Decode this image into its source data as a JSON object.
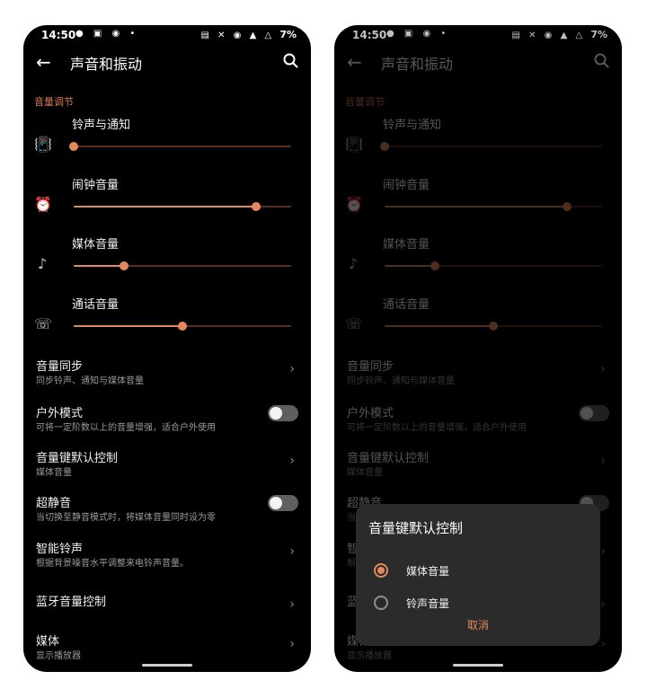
{
  "status_bar": {
    "time": "14:50",
    "battery": "7%"
  },
  "app_bar": {
    "title": "声音和振动"
  },
  "volume_section": {
    "header": "音量调节",
    "sliders": [
      {
        "label": "铃声与通知",
        "icon": "vibrate-icon",
        "value": 0.0
      },
      {
        "label": "闹钟音量",
        "icon": "alarm-icon",
        "value": 0.84
      },
      {
        "label": "媒体音量",
        "icon": "music-note-icon",
        "value": 0.23
      },
      {
        "label": "通话音量",
        "icon": "phone-icon",
        "value": 0.5
      }
    ]
  },
  "settings": [
    {
      "title": "音量同步",
      "subtitle": "同步铃声、通知与媒体音量",
      "control": "chevron"
    },
    {
      "title": "户外模式",
      "subtitle": "可将一定阶数以上的音量增强，适合户外使用",
      "control": "toggle",
      "on": false
    },
    {
      "title": "音量键默认控制",
      "subtitle": "媒体音量",
      "control": "chevron"
    },
    {
      "title": "超静音",
      "subtitle": "当切换至静音模式时，将媒体音量同时设为零",
      "control": "toggle",
      "on": false
    },
    {
      "title": "智能铃声",
      "subtitle": "根据背景噪音水平调整来电铃声音量。",
      "control": "chevron"
    },
    {
      "title": "蓝牙音量控制",
      "subtitle": "",
      "control": "chevron"
    },
    {
      "title": "媒体",
      "subtitle": "显示播放器",
      "control": "chevron"
    }
  ],
  "dialog": {
    "title": "音量键默认控制",
    "options": [
      {
        "label": "媒体音量",
        "selected": true
      },
      {
        "label": "铃声音量",
        "selected": false
      }
    ],
    "cancel": "取消"
  },
  "colors": {
    "accent": "#e2895e",
    "track": "#5a2e1e",
    "background": "#000000",
    "dialog": "#2b2b2b"
  }
}
